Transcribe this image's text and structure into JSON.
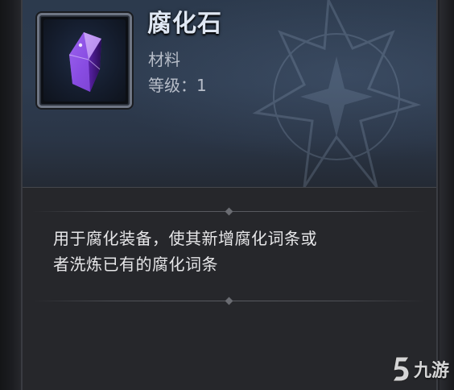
{
  "item": {
    "name": "腐化石",
    "type": "材料",
    "level_label": "等级：1",
    "icon": "purple-crystal-icon",
    "description_lines": [
      "用于腐化装备，使其新增腐化词条或",
      "者洗炼已有的腐化词条"
    ]
  },
  "watermark": {
    "text": "九游"
  },
  "colors": {
    "title": "#dfe7f3",
    "header_bg": "#2c3a4d",
    "body_bg": "#26272b",
    "text": "#e7e7e9",
    "crystal": "#7b3fd0"
  }
}
